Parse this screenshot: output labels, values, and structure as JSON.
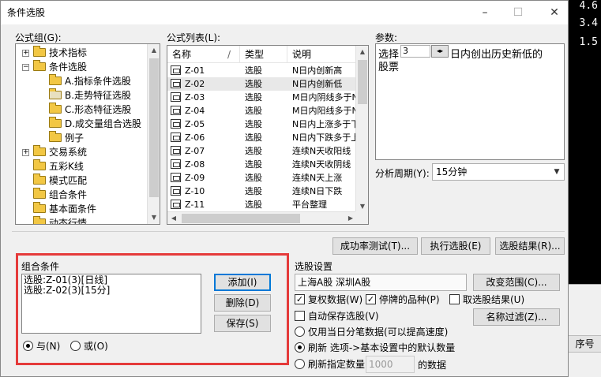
{
  "background": {
    "numbers": [
      "4.6",
      "3.4",
      "1.5"
    ],
    "grid_header": "序号"
  },
  "window": {
    "title": "条件选股",
    "minimize": "–",
    "maximize": "☐",
    "close": "✕"
  },
  "groups": {
    "label": "公式组(G):",
    "tree": [
      {
        "label": "技术指标",
        "expander": "+"
      },
      {
        "label": "条件选股",
        "expander": "−"
      },
      {
        "label": "A.指标条件选股"
      },
      {
        "label": "B.走势特征选股"
      },
      {
        "label": "C.形态特征选股"
      },
      {
        "label": "D.成交量组合选股"
      },
      {
        "label": "例子"
      },
      {
        "label": "交易系统",
        "expander": "+"
      },
      {
        "label": "五彩K线"
      },
      {
        "label": "模式匹配"
      },
      {
        "label": "组合条件"
      },
      {
        "label": "基本面条件"
      },
      {
        "label": "动态行情"
      }
    ]
  },
  "formulas": {
    "label": "公式列表(L):",
    "columns": [
      "名称",
      "/",
      "类型",
      "说明"
    ],
    "rows": [
      {
        "name": "Z-01",
        "type": "选股",
        "desc": "N日内创新高"
      },
      {
        "name": "Z-02",
        "type": "选股",
        "desc": "N日内创新低"
      },
      {
        "name": "Z-03",
        "type": "选股",
        "desc": "M日内阴线多于N"
      },
      {
        "name": "Z-04",
        "type": "选股",
        "desc": "M日内阳线多于N"
      },
      {
        "name": "Z-05",
        "type": "选股",
        "desc": "N日内上涨多于下"
      },
      {
        "name": "Z-06",
        "type": "选股",
        "desc": "N日内下跌多于上"
      },
      {
        "name": "Z-07",
        "type": "选股",
        "desc": "连续N天收阳线"
      },
      {
        "name": "Z-08",
        "type": "选股",
        "desc": "连续N天收阴线"
      },
      {
        "name": "Z-09",
        "type": "选股",
        "desc": "连续N天上涨"
      },
      {
        "name": "Z-10",
        "type": "选股",
        "desc": "连续N日下跌"
      },
      {
        "name": "Z-11",
        "type": "选股",
        "desc": "平台整理"
      }
    ]
  },
  "params": {
    "label": "参数:",
    "prefix": "选择",
    "value": "3",
    "spin": "◂▸",
    "suffix": "日内创出历史新低的",
    "line2": "股票"
  },
  "period": {
    "label": "分析周期(Y):",
    "value": "15分钟"
  },
  "buttons": {
    "success_test": "成功率测试(T)...",
    "execute": "执行选股(E)",
    "results": "选股结果(R)..."
  },
  "combo": {
    "label": "组合条件",
    "items": [
      "选股:Z-01(3)[日线]",
      "选股:Z-02(3)[15分]"
    ],
    "add": "添加(I)",
    "delete": "删除(D)",
    "save": "保存(S)",
    "and": "与(N)",
    "or": "或(O)"
  },
  "settings": {
    "label": "选股设置",
    "markets": "上海A股  深圳A股",
    "change_range": "改变范围(C)...",
    "adj_data": "复权数据(W)",
    "suspended": "停牌的品种(P)",
    "select_results": "取选股结果(U)",
    "auto_save": "自动保存选股(V)",
    "name_filter": "名称过滤(Z)...",
    "opt_day_only": "仅用当日分笔数据(可以提高速度)",
    "opt_refresh_default": "刷新 选项->基本设置中的默认数量",
    "opt_refresh_count": "刷新指定数量",
    "count": "1000",
    "unit": "的数据"
  }
}
